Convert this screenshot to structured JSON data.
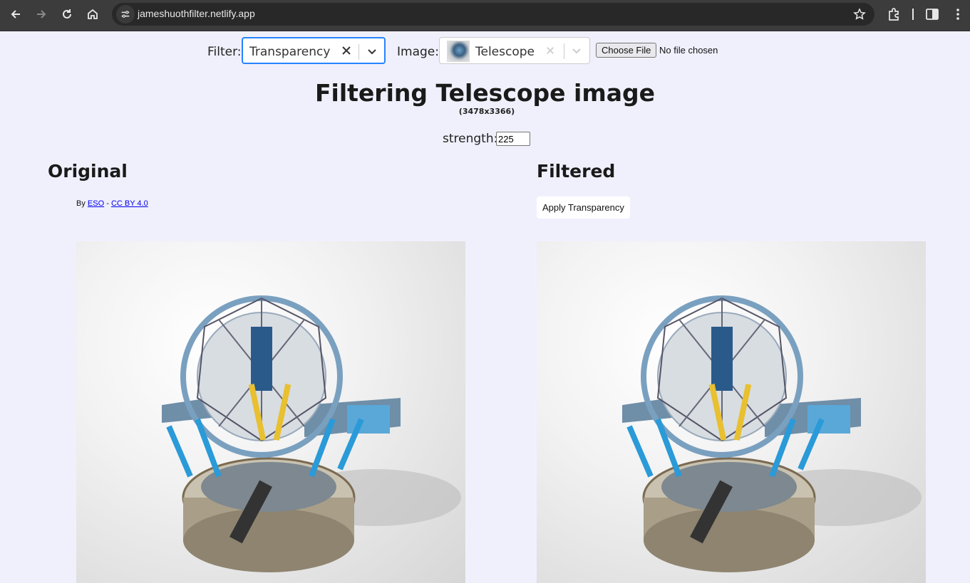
{
  "browser": {
    "url": "jameshuothfilter.netlify.app"
  },
  "toolbar": {
    "filter_label": "Filter:",
    "filter_value": "Transparency",
    "image_label": "Image:",
    "image_value": "Telescope",
    "choose_file_label": "Choose File",
    "no_file_text": "No file chosen"
  },
  "heading": {
    "title": "Filtering Telescope image",
    "dimensions": "(3478x3366)"
  },
  "strength": {
    "label": "strength:",
    "value": "225"
  },
  "original": {
    "title": "Original",
    "credit_by": "By",
    "credit_author": "ESO",
    "credit_sep": "-",
    "credit_license": "CC BY 4.0"
  },
  "filtered": {
    "title": "Filtered",
    "apply_button": "Apply Transparency"
  },
  "colors": {
    "page_bg": "#f0f0fd",
    "focus_border": "#2684ff",
    "chrome_bg": "#3c3c3c"
  },
  "icons": [
    "back-icon",
    "forward-icon",
    "reload-icon",
    "home-icon",
    "site-info-icon",
    "star-icon",
    "extensions-icon",
    "side-panel-icon",
    "menu-icon",
    "clear-icon",
    "chevron-down-icon"
  ]
}
